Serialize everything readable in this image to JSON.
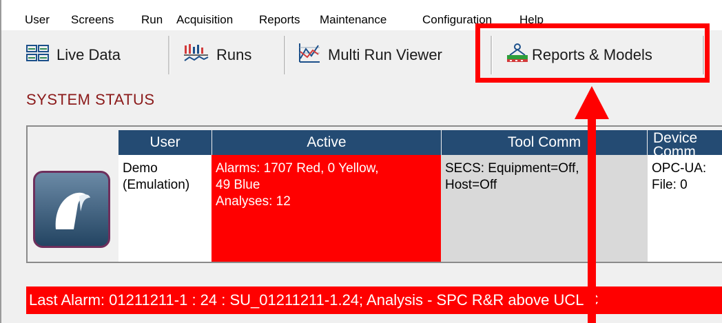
{
  "menu": {
    "items": [
      "User",
      "Screens",
      "Run",
      "Acquisition",
      "Reports",
      "Maintenance",
      "Configuration",
      "Help"
    ]
  },
  "tabs": [
    {
      "label": "Live Data",
      "icon": "live-data-icon"
    },
    {
      "label": "Runs",
      "icon": "runs-chart-icon"
    },
    {
      "label": "Multi Run Viewer",
      "icon": "multi-run-chart-icon"
    },
    {
      "label": "Reports & Models",
      "icon": "reports-models-icon"
    }
  ],
  "system_status": {
    "title": "SYSTEM  STATUS",
    "columns": [
      "User",
      "Active",
      "Tool Comm",
      "Device Comm"
    ],
    "user_cell": [
      "Demo",
      "(Emulation)"
    ],
    "active_cell": [
      "Alarms: 1707 Red, 0 Yellow,",
      "49 Blue",
      "Analyses: 12"
    ],
    "tool_cell": [
      "SECS: Equipment=Off,",
      "Host=Off"
    ],
    "device_cell": [
      "OPC-UA:",
      "File: 0"
    ]
  },
  "alarm_bar": {
    "text": "Last Alarm: 01211211-1 : 24 : SU_01211211-1.24; Analysis - SPC R&R above UCL C"
  },
  "colors": {
    "accent_red": "#ff0000",
    "header_blue": "#244b73",
    "title_red": "#8b1a1a"
  }
}
